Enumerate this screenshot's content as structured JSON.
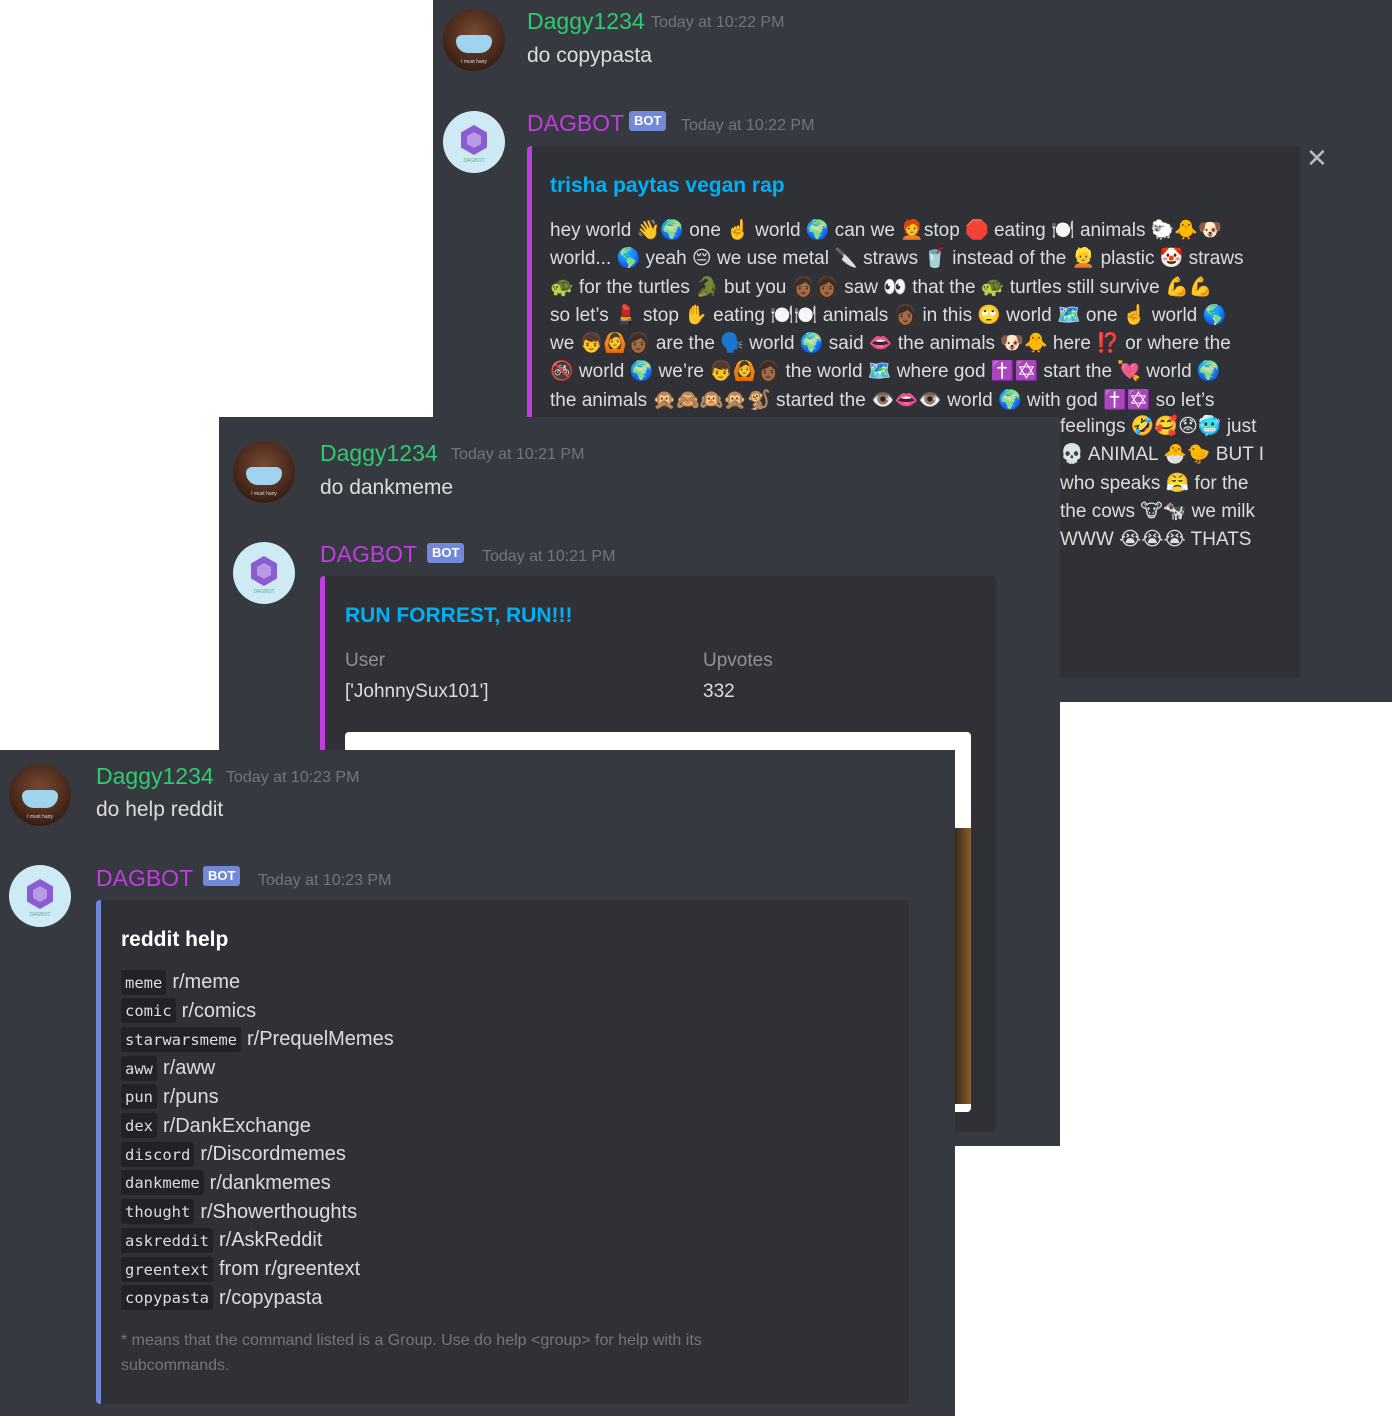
{
  "copypasta_screen": {
    "user_message": {
      "username": "Daggy1234",
      "timestamp": "Today at 10:22 PM",
      "text": "do copypasta"
    },
    "bot_message": {
      "username": "DAGBOT",
      "badge": "BOT",
      "timestamp": "Today at 10:22 PM",
      "embed": {
        "title": "trisha paytas vegan rap",
        "lines": [
          "hey world 👋🌍 one ☝️ world 🌍 can we 🧑‍🦰stop 🛑 eating 🍽️ animals 🐑🐥🐶",
          "world... 🌎 yeah 😔 we use metal 🔪 straws 🥤 instead of the 👱 plastic 🤡 straws",
          "🐢 for the turtles 🐊 but you 👩🏾👩🏾 saw 👀 that the 🐢 turtles still survive 💪💪",
          "so let’s 💄 stop ✋ eating 🍽️🍽️ animals 👩🏾 in this 🙄 world 🗺️ one ☝️ world 🌎",
          "we 👦🙆👩🏾 are the 🗣️ world 🌍 said 👄 the animals 🐶🐥 here ⁉️ or where the",
          "🚳 world 🌍 we’re 👦🙆👩🏾 the world 🗺️ where god ✝️✡️ start the 💘 world 🌍",
          "the animals 🙊🙈🙉🙊🐒 started the 👁️👄👁️ world 🌍 with god ✝️✡️ so let’s",
          "feelings 🤣🥰😟🥶 just",
          "💀 ANIMAL 🐣🐤 BUT I",
          "who speaks 😤 for the",
          "the cows 🐮🐄 we milk",
          "WWW 😭😭😭 THATS"
        ]
      }
    }
  },
  "dankmeme_screen": {
    "user_message": {
      "username": "Daggy1234",
      "timestamp": "Today at 10:21 PM",
      "text": "do dankmeme"
    },
    "bot_message": {
      "username": "DAGBOT",
      "badge": "BOT",
      "timestamp": "Today at 10:21 PM",
      "embed": {
        "title": "RUN FORREST, RUN!!!",
        "fields": [
          {
            "name": "User",
            "value": "['JohnnySux101']"
          },
          {
            "name": "Upvotes",
            "value": "332"
          }
        ]
      }
    }
  },
  "help_screen": {
    "user_message": {
      "username": "Daggy1234",
      "timestamp": "Today at 10:23 PM",
      "text": "do help reddit"
    },
    "bot_message": {
      "username": "DAGBOT",
      "badge": "BOT",
      "timestamp": "Today at 10:23 PM",
      "embed": {
        "title": "reddit help",
        "commands": [
          {
            "cmd": "meme",
            "sub": "r/meme"
          },
          {
            "cmd": "comic",
            "sub": "r/comics"
          },
          {
            "cmd": "starwarsmeme",
            "sub": "r/PrequelMemes"
          },
          {
            "cmd": "aww",
            "sub": "r/aww"
          },
          {
            "cmd": "pun",
            "sub": "r/puns"
          },
          {
            "cmd": "dex",
            "sub": "r/DankExchange"
          },
          {
            "cmd": "discord",
            "sub": "r/Discordmemes"
          },
          {
            "cmd": "dankmeme",
            "sub": "r/dankmemes"
          },
          {
            "cmd": "thought",
            "sub": "r/Showerthoughts"
          },
          {
            "cmd": "askreddit",
            "sub": "r/AskReddit"
          },
          {
            "cmd": "greentext",
            "sub": "from r/greentext"
          },
          {
            "cmd": "copypasta",
            "sub": "r/copypasta"
          }
        ],
        "footer_line1": "* means that the command listed is a Group. Use do help <group> for help with its",
        "footer_line2": "subcommands."
      }
    }
  },
  "avatar_captions": {
    "user": "I must hairy",
    "bot": "DAGBOT"
  },
  "colors": {
    "background": "#36393f",
    "embed": "#2f3136",
    "accent_purple": "#c13de0",
    "accent_blue": "#7289da",
    "username_green": "#2ecc71",
    "link_blue": "#00b0f4"
  }
}
